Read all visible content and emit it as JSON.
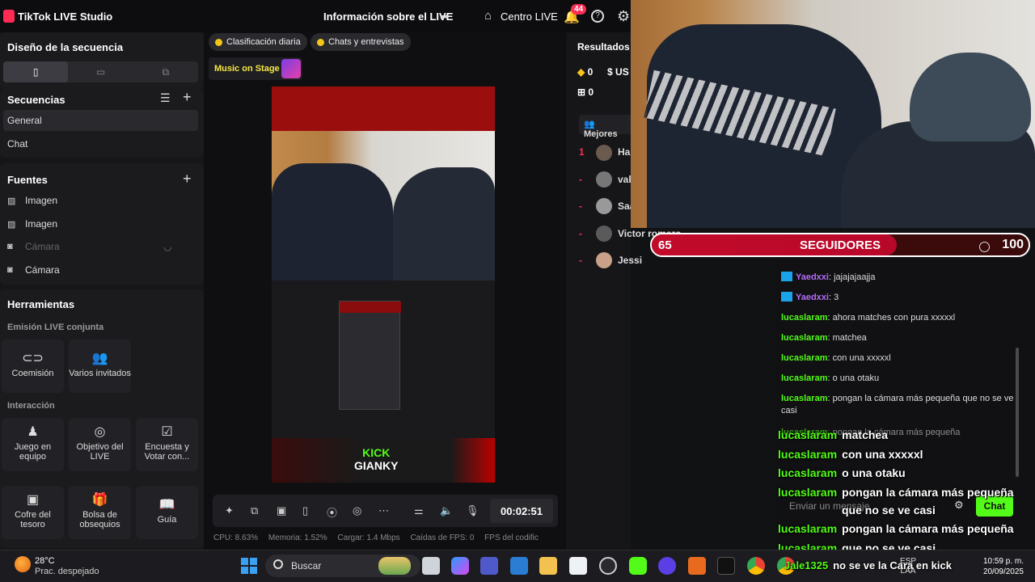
{
  "app": {
    "title": "TikTok LIVE Studio",
    "live_info": "Información sobre el LIVE",
    "centro": "Centro LIVE",
    "notif_count": "44"
  },
  "left": {
    "design_title": "Diseño de la secuencia",
    "sequences_title": "Secuencias",
    "sequences": [
      "General",
      "Chat"
    ],
    "sources_title": "Fuentes",
    "sources": [
      "Imagen",
      "Imagen",
      "Cámara",
      "Cámara"
    ],
    "tools_title": "Herramientas",
    "emission_label": "Emisión LIVE conjunta",
    "emission_tools": [
      "Coemisión",
      "Varios invitados"
    ],
    "interaction_label": "Interacción",
    "interaction_tools": [
      "Juego en equipo",
      "Objetivo del LIVE",
      "Encuesta y Votar con..."
    ],
    "extra_tools": [
      "Cofre del tesoro",
      "Bolsa de obsequios",
      "Guía"
    ]
  },
  "center": {
    "pill_daily": "Clasificación diaria",
    "pill_chats": "Chats y entrevistas",
    "music": "Music on Stage",
    "kick_line1": "KICK",
    "kick_line2": "GIANKY",
    "timer": "00:02:51",
    "stats": {
      "cpu": "CPU: 8.63%",
      "mem": "Memoria: 1.52%",
      "load": "Cargar: 1.4 Mbps",
      "fps": "Caídas de FPS: 0",
      "fps_codec": "FPS del codific"
    }
  },
  "right": {
    "title": "Resultados c",
    "coins": "0",
    "usd": "US",
    "gifts": "0",
    "mejores": "Mejores",
    "ranking": [
      {
        "rank": "1",
        "name": "Hai"
      },
      {
        "rank": "-",
        "name": "val"
      },
      {
        "rank": "-",
        "name": "Saa"
      },
      {
        "rank": "-",
        "name": "Victor romero"
      },
      {
        "rank": "-",
        "name": "Jessi"
      }
    ]
  },
  "overlay": {
    "current": "65",
    "label": "SEGUIDORES",
    "goal": "100",
    "progress": 0.65
  },
  "chat": {
    "messages": [
      {
        "user": "Yaedxxi",
        "text": "jajajajaajja",
        "purple": true
      },
      {
        "user": "Yaedxxi",
        "text": "3",
        "purple": true
      },
      {
        "user": "lucaslaram",
        "text": "ahora matches con pura xxxxxl"
      },
      {
        "user": "lucaslaram",
        "text": "matchea"
      },
      {
        "user": "lucaslaram",
        "text": "con una xxxxxl"
      },
      {
        "user": "lucaslaram",
        "text": "o una otaku"
      },
      {
        "user": "lucaslaram",
        "text": "pongan la cámara más pequeña que no se ve casi"
      },
      {
        "user": "lucaslaram",
        "text": "pongan la cámara más pequeña"
      }
    ],
    "input_placeholder": "Enviar un mensaje",
    "send_label": "Chat",
    "overlay_msgs": [
      {
        "user": "lucaslaram",
        "text": "matchea"
      },
      {
        "user": "lucaslaram",
        "text": "con una xxxxxl"
      },
      {
        "user": "lucaslaram",
        "text": "o una otaku"
      },
      {
        "user": "lucaslaram",
        "text": "pongan la cámara más pequeña"
      },
      {
        "user": "",
        "text": "que no se ve casi"
      },
      {
        "user": "lucaslaram",
        "text": "pongan la cámara más pequeña"
      },
      {
        "user": "lucaslaram",
        "text": "que no se ve casi"
      },
      {
        "user": "Jale1325",
        "text": "no se ve la Cara en kick"
      }
    ]
  },
  "taskbar": {
    "temp": "28°C",
    "condition": "Prac. despejado",
    "search": "Buscar",
    "lang1": "ESP",
    "lang2": "LAA",
    "time": "10:59 p. m.",
    "date": "20/09/2025"
  }
}
